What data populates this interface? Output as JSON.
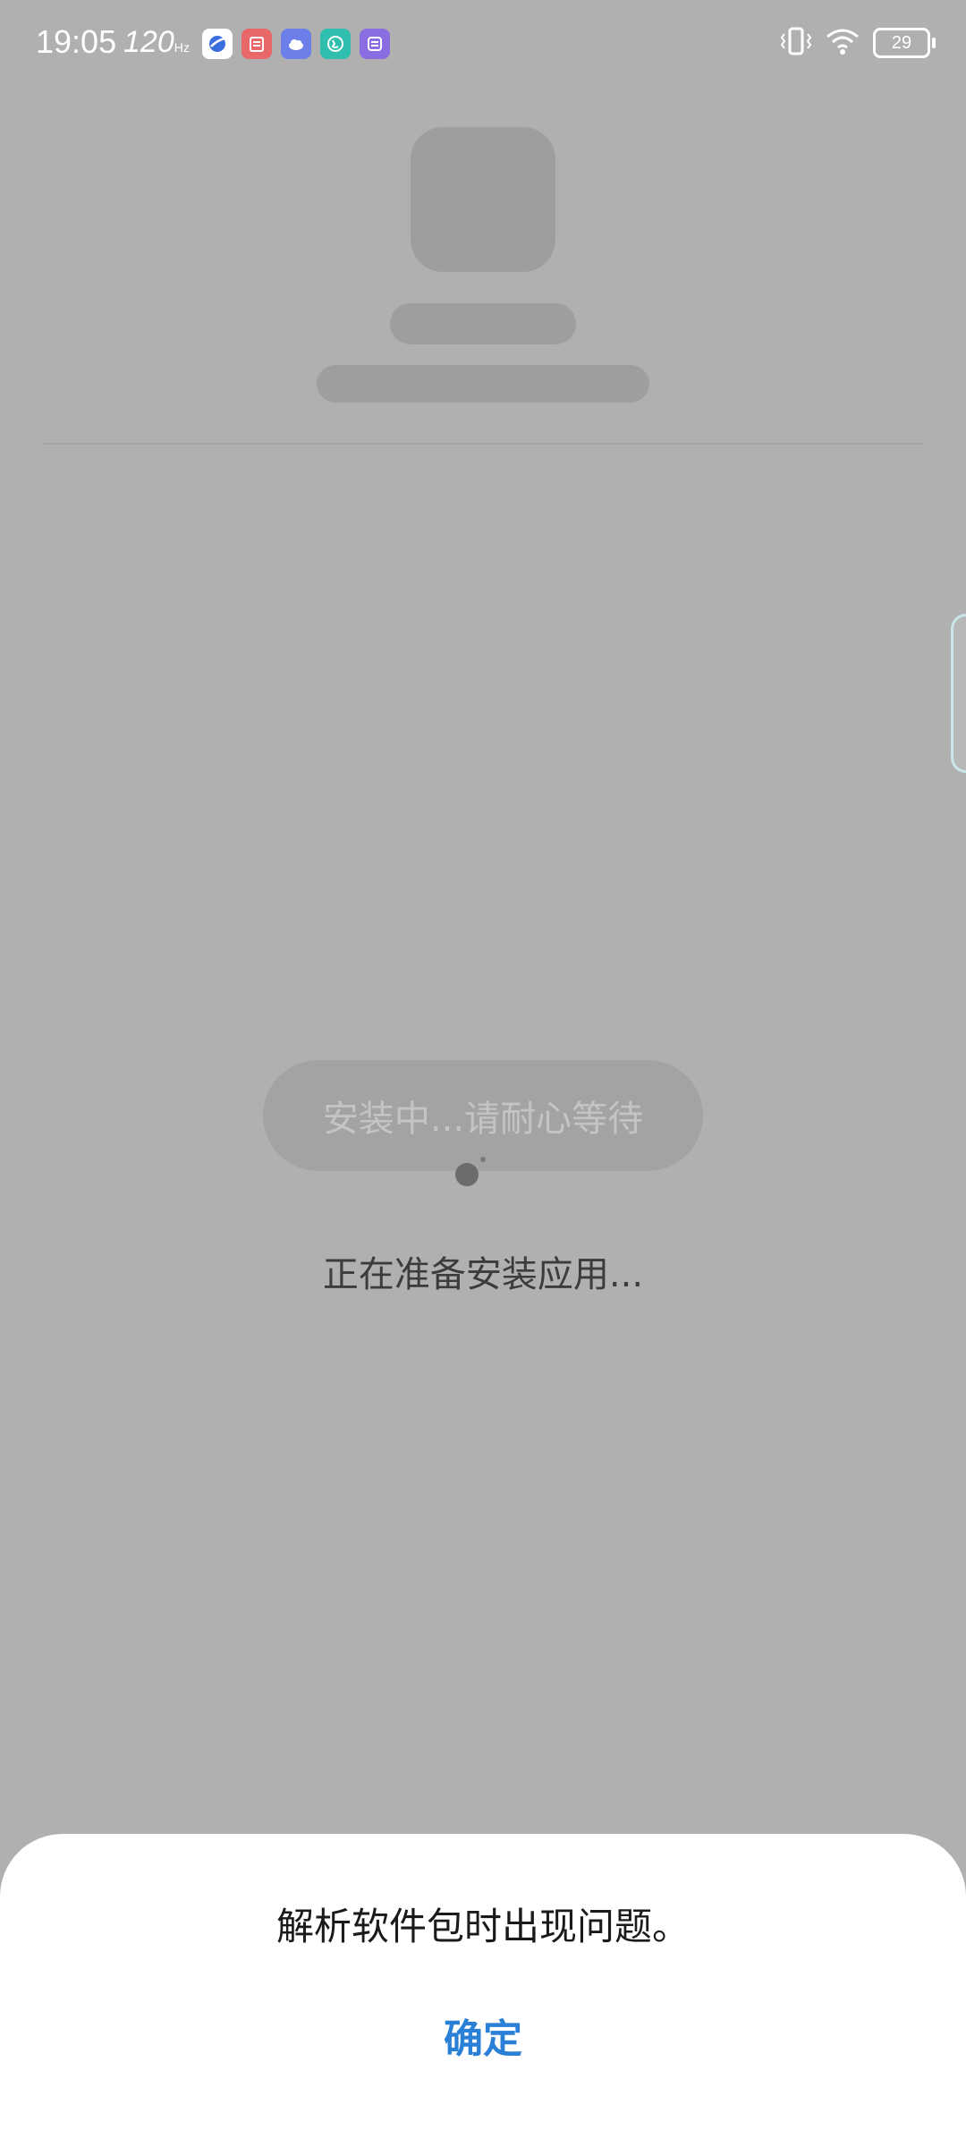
{
  "status_bar": {
    "time": "19:05",
    "refresh_rate": "120",
    "refresh_unit": "Hz",
    "battery": "29",
    "notification_icons": [
      {
        "name": "browser-icon",
        "color": "#ffffff",
        "fg": "#3b6fe0"
      },
      {
        "name": "calendar-icon",
        "color": "#e8686a",
        "fg": "#ffffff"
      },
      {
        "name": "weather-icon",
        "color": "#6c7fe8",
        "fg": "#ffffff"
      },
      {
        "name": "phone-app-icon",
        "color": "#2fbfae",
        "fg": "#ffffff"
      },
      {
        "name": "toolbox-icon",
        "color": "#8a6de0",
        "fg": "#ffffff"
      }
    ]
  },
  "install": {
    "button_label": "安装中...请耐心等待",
    "status_text": "正在准备安装应用..."
  },
  "dialog": {
    "message": "解析软件包时出现问题。",
    "confirm_label": "确定"
  },
  "colors": {
    "accent": "#2a7fd6",
    "overlay": "#b0b0b0"
  }
}
